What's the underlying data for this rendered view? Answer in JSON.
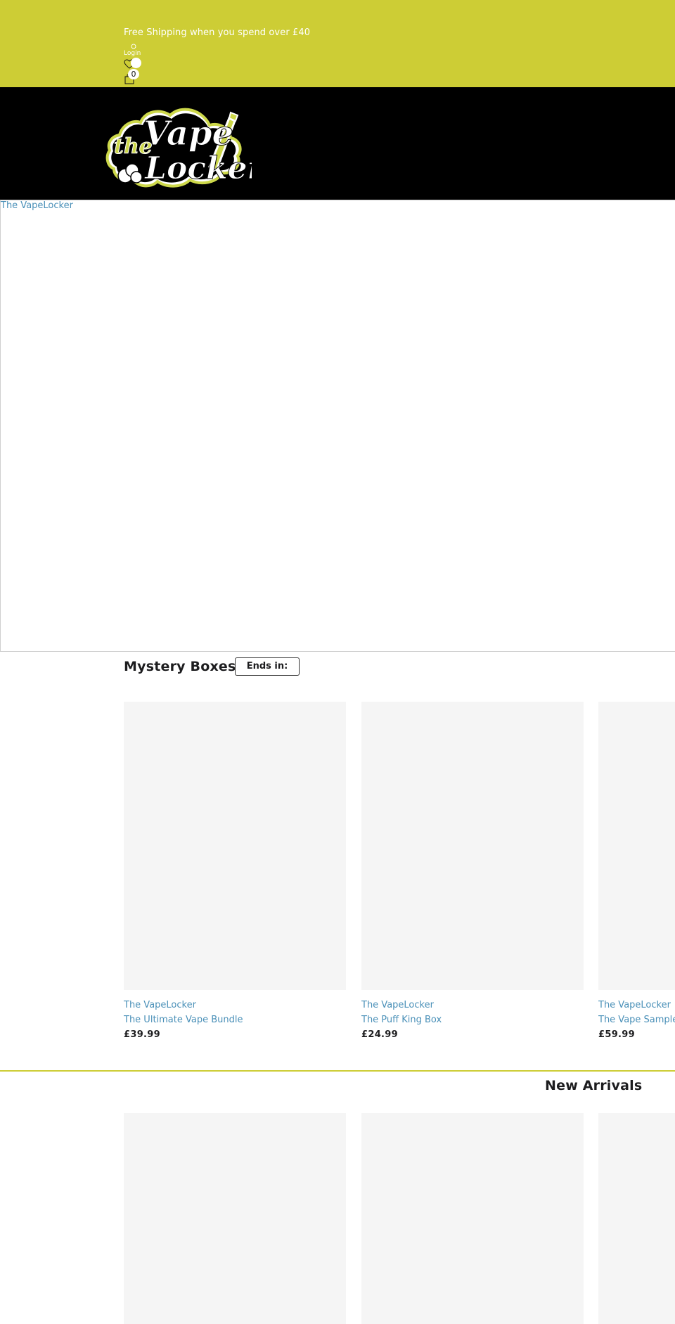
{
  "header": {
    "announcement": "Free Shipping when you spend over £40",
    "login_label": "Login",
    "cart_count": "0"
  },
  "hero": {
    "alt_text": "The VapeLocker"
  },
  "mystery": {
    "title": "Mystery Boxes",
    "ends_label": "Ends in:",
    "products": [
      {
        "vendor": "The VapeLocker",
        "name": "The Ultimate Vape Bundle",
        "price": "£39.99"
      },
      {
        "vendor": "The VapeLocker",
        "name": "The Puff King Box",
        "price": "£24.99"
      },
      {
        "vendor": "The VapeLocker",
        "name": "The Vape Sampler",
        "price": "£59.99"
      }
    ]
  },
  "new_arrivals": {
    "title": "New Arrivals"
  },
  "colors": {
    "brand_yellow": "#cdcd35",
    "header_black": "#000000",
    "link_blue": "#4a90b8",
    "placeholder_grey": "#f5f5f5"
  },
  "icons": {
    "account": "user-icon",
    "wishlist": "heart-icon",
    "cart": "bag-icon"
  }
}
